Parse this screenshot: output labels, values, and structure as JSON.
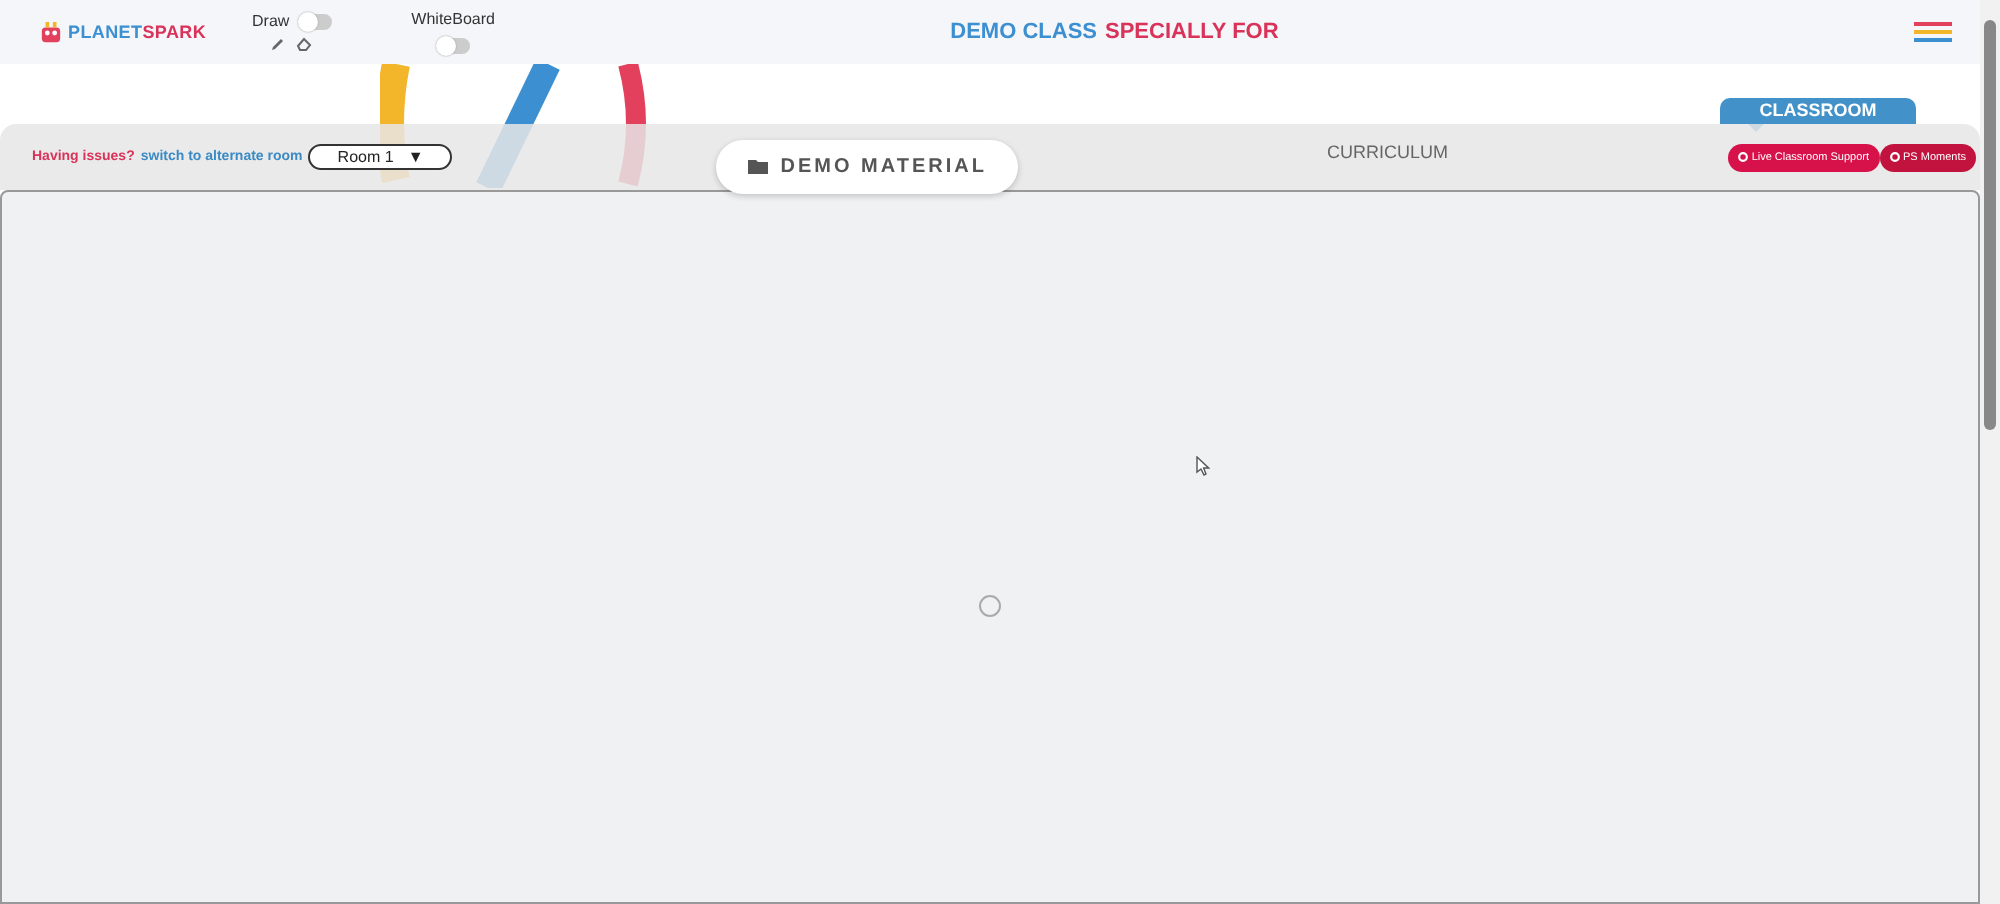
{
  "header": {
    "logo": {
      "part_1": "PLANET",
      "part_2": "SPARK"
    },
    "draw_toggle": {
      "label": "Draw",
      "on": false
    },
    "whiteboard_toggle": {
      "label": "WhiteBoard",
      "on": false
    },
    "title": {
      "part_1": "DEMO CLASS",
      "part_2": "SPECIALLY FOR"
    }
  },
  "classroom_tab": {
    "label": "CLASSROOM"
  },
  "toolbar": {
    "issue_text": "Having issues?",
    "issue_link": "switch to alternate room",
    "room_select": {
      "value": "Room 1",
      "caret": "▼"
    },
    "tabs": [
      {
        "label": "DEMO MATERIAL",
        "selected": true
      },
      {
        "label": "CURRICULUM",
        "selected": false
      }
    ],
    "buttons": [
      {
        "label": "Live Classroom Support"
      },
      {
        "label": "PS Moments"
      }
    ]
  }
}
